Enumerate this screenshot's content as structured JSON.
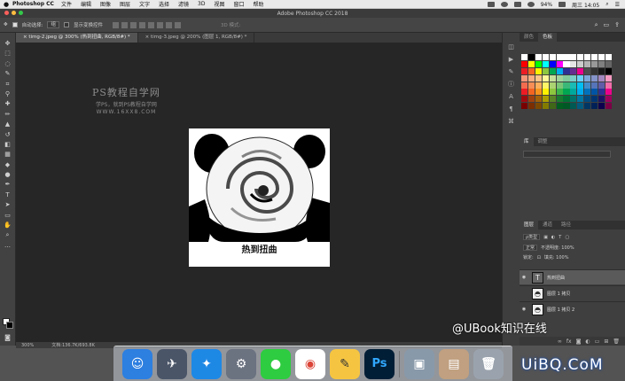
{
  "menubar": {
    "app_name": "Photoshop CC",
    "items": [
      "文件",
      "编辑",
      "图像",
      "图层",
      "文字",
      "选择",
      "滤镜",
      "3D",
      "视图",
      "窗口",
      "帮助"
    ],
    "battery": "94%",
    "clock": "周三 14:05"
  },
  "window": {
    "title": "Adobe Photoshop CC 2018"
  },
  "options": {
    "auto_select_label": "自动选择:",
    "auto_select_value": "组",
    "show_transform_label": "显示变换控件",
    "mode_3d_label": "3D 模式:"
  },
  "tabs": [
    {
      "label": "timg-2.jpeg @ 300% (热到扭曲, RGB/8#) *"
    },
    {
      "label": "timg-3.jpeg @ 200% (图层 1, RGB/8#) *"
    }
  ],
  "canvas": {
    "watermark_title": "PS教程自学网",
    "watermark_sub": "学PS，就到PS教程自学网",
    "watermark_url": "WWW.16XX8.COM",
    "doc_caption": "热到扭曲"
  },
  "status": {
    "zoom": "300%",
    "doc_size": "文档:136.7K/693.8K"
  },
  "swatches_panel": {
    "tabs": [
      "颜色",
      "色板"
    ],
    "grid": [
      [
        "#ffffff",
        "#000000",
        "#ffffff",
        "#ffffff",
        "#ffffff",
        "#ffffff",
        "#ffffff",
        "#ffffff",
        "#ffffff",
        "#ffffff",
        "#ffffff",
        "#ffffff",
        "#ffffff"
      ],
      [
        "#ff0000",
        "#ffff00",
        "#00ff00",
        "#00ffff",
        "#0000ff",
        "#ff00ff",
        "#ffffff",
        "#e6e6e6",
        "#cccccc",
        "#b3b3b3",
        "#999999",
        "#808080",
        "#666666"
      ],
      [
        "#ed1c24",
        "#f26522",
        "#fff200",
        "#8dc63f",
        "#00a651",
        "#00aeef",
        "#2e3192",
        "#662d91",
        "#ec008c",
        "#4d4d4d",
        "#333333",
        "#1a1a1a",
        "#000000"
      ],
      [
        "#f69679",
        "#f9ad81",
        "#fdc689",
        "#fff799",
        "#c4df9b",
        "#a3d39c",
        "#82ca9c",
        "#7accc8",
        "#6dcff6",
        "#7da7d9",
        "#8493ca",
        "#a187be",
        "#f49ac1"
      ],
      [
        "#f26c4f",
        "#f68e55",
        "#fbaf5c",
        "#fff467",
        "#acd372",
        "#7cc576",
        "#3bb878",
        "#1abbb4",
        "#00bff3",
        "#438ccb",
        "#5574b9",
        "#605ca8",
        "#f06eaa"
      ],
      [
        "#ed1c24",
        "#f26522",
        "#f7941d",
        "#fff200",
        "#8dc63f",
        "#39b54a",
        "#00a651",
        "#00a99d",
        "#00aeef",
        "#0072bc",
        "#0054a6",
        "#2e3192",
        "#ec008c"
      ],
      [
        "#9e0b0f",
        "#a0410d",
        "#a36209",
        "#aba000",
        "#598527",
        "#1a7b30",
        "#007236",
        "#00746b",
        "#0076a3",
        "#004b80",
        "#003471",
        "#1b1464",
        "#9e005d"
      ],
      [
        "#790000",
        "#7b2e00",
        "#7d4900",
        "#827b00",
        "#406618",
        "#005e20",
        "#005826",
        "#005952",
        "#005b7f",
        "#003663",
        "#002157",
        "#0d004c",
        "#7b0046"
      ]
    ]
  },
  "libraries_panel": {
    "tabs": [
      "库",
      "调整"
    ]
  },
  "layers_panel": {
    "tabs": [
      "图层",
      "通道",
      "路径"
    ],
    "kind_filter": "ρ类型",
    "blend_mode": "正常",
    "opacity_label": "不透明度: 100%",
    "lock_label": "锁定:",
    "fill_label": "填充: 100%",
    "layers": [
      {
        "name": "热到扭曲",
        "type": "text"
      },
      {
        "name": "图层 1 拷贝",
        "type": "image"
      },
      {
        "name": "图层 1 拷贝 2",
        "type": "image"
      }
    ]
  },
  "overlay": {
    "credit": "@UBook知识在线"
  }
}
